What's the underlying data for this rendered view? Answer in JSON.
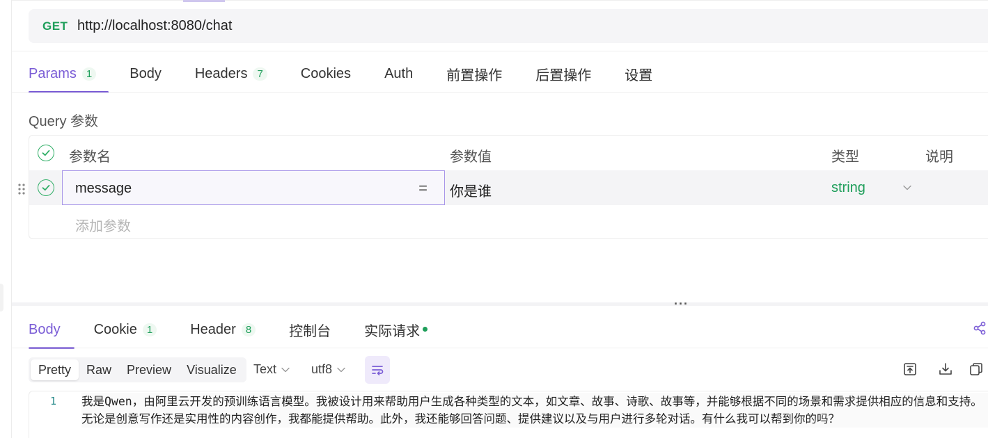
{
  "request": {
    "method": "GET",
    "url": "http://localhost:8080/chat"
  },
  "request_tabs": [
    {
      "label": "Params",
      "badge": "1"
    },
    {
      "label": "Body",
      "badge": ""
    },
    {
      "label": "Headers",
      "badge": "7"
    },
    {
      "label": "Cookies",
      "badge": ""
    },
    {
      "label": "Auth",
      "badge": ""
    },
    {
      "label": "前置操作",
      "badge": ""
    },
    {
      "label": "后置操作",
      "badge": ""
    },
    {
      "label": "设置",
      "badge": ""
    }
  ],
  "query": {
    "title": "Query 参数",
    "headers": {
      "name": "参数名",
      "value": "参数值",
      "type": "类型",
      "desc": "说明"
    },
    "rows": [
      {
        "name": "message",
        "equals": "=",
        "value": "你是谁",
        "type": "string"
      }
    ],
    "add_placeholder": "添加参数"
  },
  "response_tabs": [
    {
      "label": "Body",
      "badge": ""
    },
    {
      "label": "Cookie",
      "badge": "1"
    },
    {
      "label": "Header",
      "badge": "8"
    },
    {
      "label": "控制台",
      "badge": ""
    },
    {
      "label": "实际请求",
      "badge": ""
    }
  ],
  "view_modes": [
    "Pretty",
    "Raw",
    "Preview",
    "Visualize"
  ],
  "format": {
    "type": "Text",
    "encoding": "utf8"
  },
  "response_body": {
    "line_number": "1",
    "text": "我是Qwen，由阿里云开发的预训练语言模型。我被设计用来帮助用户生成各种类型的文本，如文章、故事、诗歌、故事等，并能够根据不同的场景和需求提供相应的信息和支持。无论是创意写作还是实用性的内容创作，我都能提供帮助。此外，我还能够回答问题、提供建议以及与用户进行多轮对话。有什么我可以帮到你的吗？"
  },
  "colors": {
    "accent": "#7a5cd6",
    "success": "#1e9e5a"
  }
}
